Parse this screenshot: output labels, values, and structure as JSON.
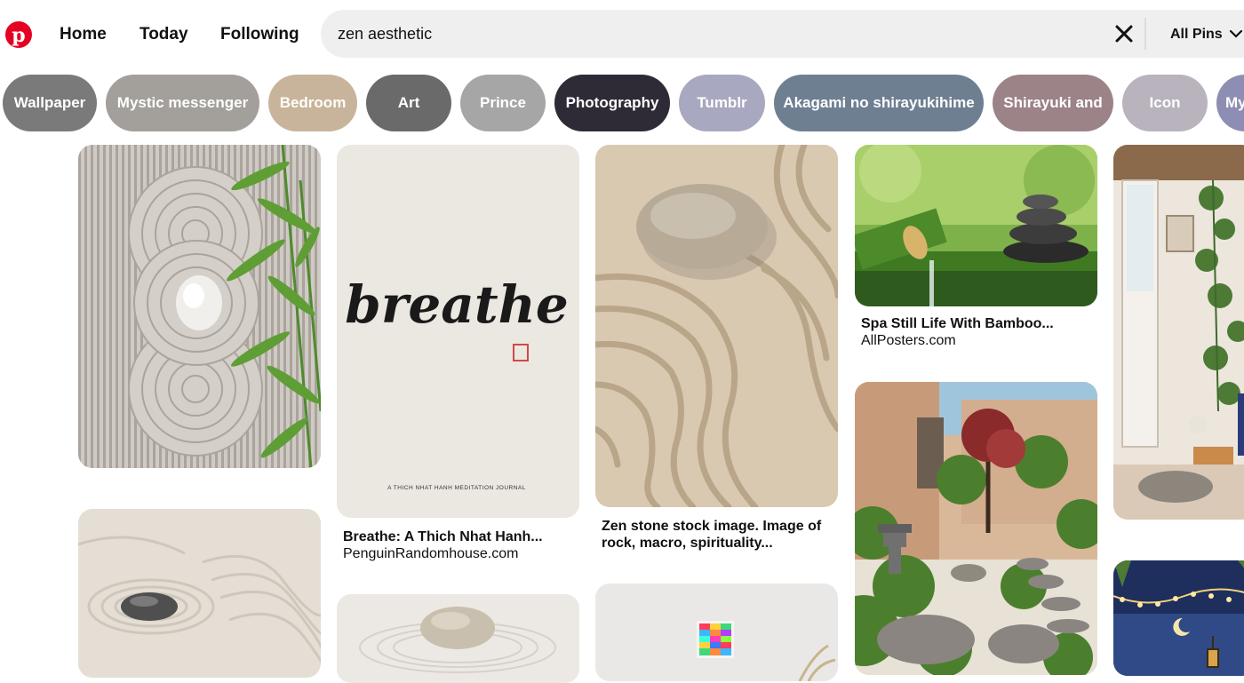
{
  "nav": {
    "home": "Home",
    "today": "Today",
    "following": "Following"
  },
  "search": {
    "query": "zen aesthetic",
    "scope": "All Pins"
  },
  "icons": {
    "logo": "pinterest-logo-icon",
    "clear": "close-icon",
    "scope": "chevron-down-icon"
  },
  "colors": {
    "brand": "#e60023"
  },
  "chips": [
    {
      "label": "Wallpaper",
      "color": "#7a7a7a"
    },
    {
      "label": "Mystic messenger",
      "color": "#a39f9b"
    },
    {
      "label": "Bedroom",
      "color": "#c8b49a"
    },
    {
      "label": "Art",
      "color": "#6a6a6a"
    },
    {
      "label": "Prince",
      "color": "#a6a6a6"
    },
    {
      "label": "Photography",
      "color": "#2f2b36"
    },
    {
      "label": "Tumblr",
      "color": "#a8a8c0"
    },
    {
      "label": "Akagami no shirayukihime",
      "color": "#6f7f92"
    },
    {
      "label": "Shirayuki and",
      "color": "#9c8388"
    },
    {
      "label": "Icon",
      "color": "#b8b3bd"
    },
    {
      "label": "My",
      "color": "#8e8eb4"
    }
  ],
  "pins": {
    "breathe": {
      "title": "Breathe: A Thich Nhat Hanh...",
      "source": "PenguinRandomhouse.com",
      "cover_word": "breathe",
      "cover_caption": "A THICH NHAT HANH MEDITATION JOURNAL"
    },
    "zen_stone": {
      "title_line1": "Zen stone stock image. Image of",
      "title_line2": "rock, macro, spirituality..."
    },
    "spa": {
      "title": "Spa Still Life With Bamboo...",
      "source": "AllPosters.com"
    }
  }
}
